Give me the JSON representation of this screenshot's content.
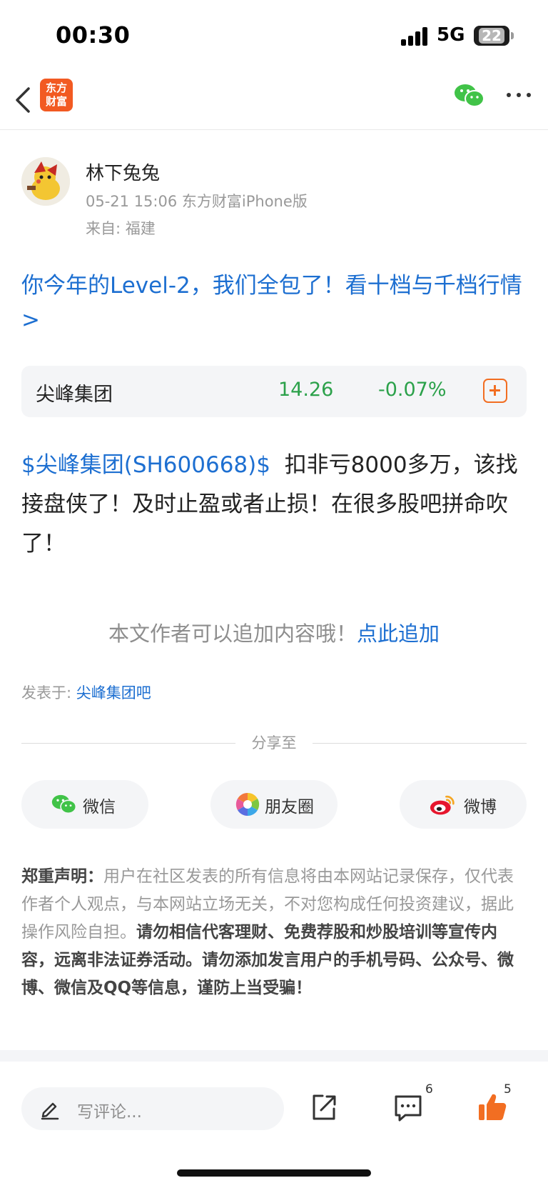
{
  "status_bar": {
    "time": "00:30",
    "network": "5G",
    "battery": "22"
  },
  "nav": {
    "logo_text_line1": "东方",
    "logo_text_line2": "财富"
  },
  "author": {
    "name": "林下兔兔",
    "meta": "05-21 15:06 东方财富iPhone版",
    "location": "来自: 福建"
  },
  "promo": {
    "text": "你今年的Level-2，我们全包了！看十档与千档行情>"
  },
  "stock": {
    "name": "尖峰集团",
    "price": "14.26",
    "change": "-0.07%"
  },
  "post": {
    "tag": "$尖峰集团(SH600668)$",
    "content": "扣非亏8000多万，该找接盘侠了！及时止盈或者止损！在很多股吧拼命吹了！"
  },
  "append_notice": {
    "text": "本文作者可以追加内容哦！",
    "link": "点此追加"
  },
  "posted_in": {
    "label": "发表于: ",
    "bar": "尖峰集团吧"
  },
  "share": {
    "title": "分享至",
    "buttons": [
      {
        "label": "微信",
        "icon": "wechat-icon"
      },
      {
        "label": "朋友圈",
        "icon": "moments-icon"
      },
      {
        "label": "微博",
        "icon": "weibo-icon"
      }
    ]
  },
  "disclaimer": {
    "title": "郑重声明：",
    "normal": "用户在社区发表的所有信息将由本网站记录保存，仅代表作者个人观点，与本网站立场无关，不对您构成任何投资建议，据此操作风险自担。",
    "bold": "请勿相信代客理财、免费荐股和炒股培训等宣传内容，远离非法证券活动。请勿添加发言用户的手机号码、公众号、微博、微信及QQ等信息，谨防上当受骗！"
  },
  "bottom_bar": {
    "comment_placeholder": "写评论...",
    "comment_count": "6",
    "like_count": "5"
  },
  "colors": {
    "link": "#1d6fd1",
    "down": "#2ba14a",
    "brand": "#f25a22",
    "like": "#f26e22"
  }
}
